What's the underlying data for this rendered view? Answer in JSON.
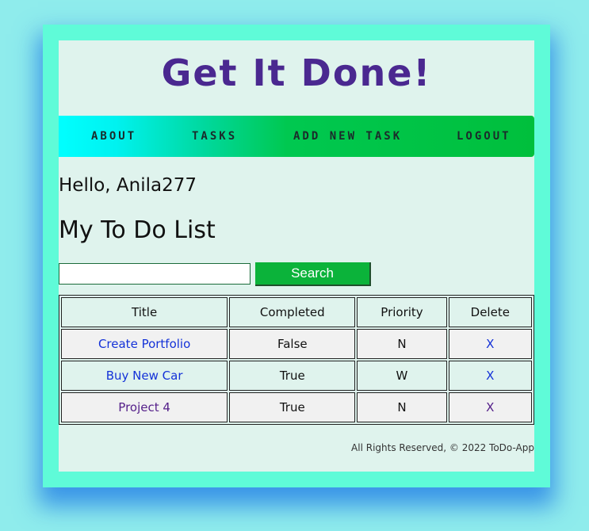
{
  "header": {
    "title": "Get It Done!"
  },
  "nav": {
    "items": [
      {
        "label": "ABOUT"
      },
      {
        "label": "TASKS"
      },
      {
        "label": "ADD NEW TASK"
      },
      {
        "label": "LOGOUT"
      }
    ]
  },
  "main": {
    "greeting": "Hello, Anila277",
    "list_title": "My To Do List",
    "search": {
      "value": "",
      "placeholder": "",
      "button_label": "Search"
    },
    "table": {
      "headers": [
        "Title",
        "Completed",
        "Priority",
        "Delete"
      ],
      "rows": [
        {
          "title": "Create Portfolio",
          "completed": "False",
          "priority": "N",
          "delete": "X"
        },
        {
          "title": "Buy New Car",
          "completed": "True",
          "priority": "W",
          "delete": "X"
        },
        {
          "title": "Project 4",
          "completed": "True",
          "priority": "N",
          "delete": "X"
        }
      ]
    }
  },
  "footer": {
    "text": "All Rights Reserved, © 2022 ToDo-App"
  },
  "colors": {
    "background": "#8fecec",
    "frame": "#5ffbd8",
    "panel": "#dff3ed",
    "title": "#4a2890",
    "accent_green": "#0bb33a",
    "link": "#1432d8",
    "link_visited": "#55208a"
  }
}
